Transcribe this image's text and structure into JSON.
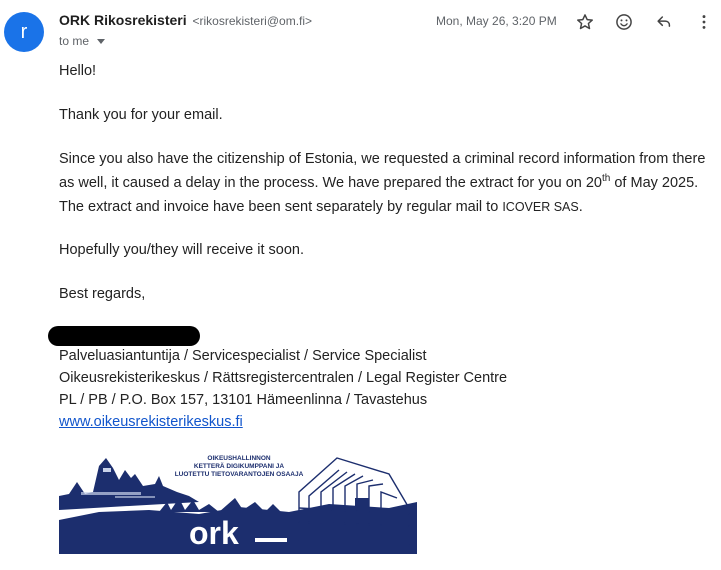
{
  "sender": {
    "avatar_letter": "r",
    "name": "ORK Rikosrekisteri",
    "email": "<rikosrekisteri@om.fi>",
    "to_label": "to me"
  },
  "date": "Mon, May 26, 3:20 PM",
  "actions": {
    "star_icon": "star-outline-icon",
    "emoji_icon": "emoji-react-icon",
    "reply_icon": "reply-icon",
    "more_icon": "more-vert-icon"
  },
  "message": {
    "greeting": "Hello!",
    "thanks": "Thank you for your email.",
    "para_part1": "Since you also have the citizenship of Estonia, we requested a criminal record information from there as well, it caused a delay in the process. We have prepared the extract for you on 20",
    "para_sup": "th",
    "para_part2": " of May 2025. The extract and invoice have been sent separately by regular mail to ",
    "para_company": "ICOVER SAS",
    "para_end": ".",
    "hope": "Hopefully you/they will receive it soon.",
    "regards": "Best regards,"
  },
  "signature": {
    "title": "Palveluasiantuntija / Servicespecialist / Service Specialist",
    "org": "Oikeusrekisterikeskus / Rättsregistercentralen / Legal Register Centre",
    "address": "PL / PB / P.O. Box 157, 13101 Hämeenlinna / Tavastehus",
    "website": "www.oikeusrekisterikeskus.fi"
  },
  "banner": {
    "line1": "OIKEUSHALLINNON",
    "line2": "KETTERÄ DIGIKUMPPANI JA",
    "line3": "LUOTETTU TIETOVARANTOJEN OSAAJA",
    "logo": "ork",
    "color": "#1c2e6e"
  }
}
